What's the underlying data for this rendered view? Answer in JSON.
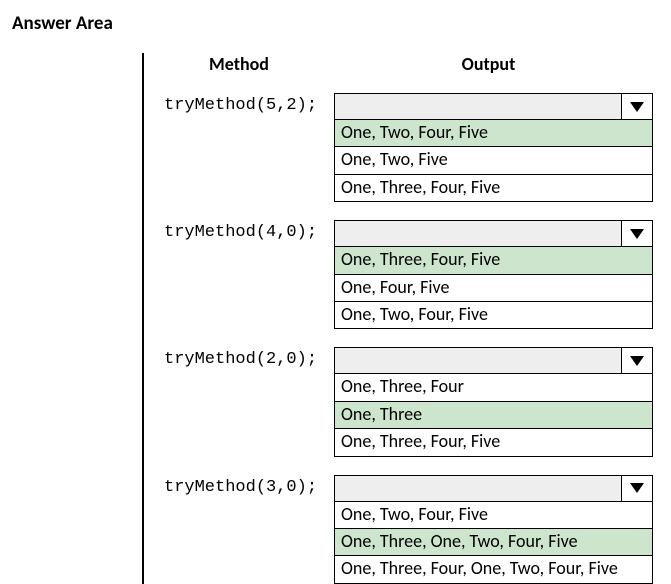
{
  "title": "Answer Area",
  "headers": {
    "method": "Method",
    "output": "Output"
  },
  "rows": [
    {
      "method": "tryMethod(5,2);",
      "options": [
        {
          "text": "One, Two, Four, Five",
          "highlight": true
        },
        {
          "text": "One, Two, Five",
          "highlight": false
        },
        {
          "text": "One, Three, Four, Five",
          "highlight": false
        }
      ]
    },
    {
      "method": "tryMethod(4,0);",
      "options": [
        {
          "text": "One, Three, Four, Five",
          "highlight": true
        },
        {
          "text": "One, Four, Five",
          "highlight": false
        },
        {
          "text": "One, Two, Four, Five",
          "highlight": false
        }
      ]
    },
    {
      "method": "tryMethod(2,0);",
      "options": [
        {
          "text": "One, Three, Four",
          "highlight": false
        },
        {
          "text": "One, Three",
          "highlight": true
        },
        {
          "text": "One, Three, Four, Five",
          "highlight": false
        }
      ]
    },
    {
      "method": "tryMethod(3,0);",
      "options": [
        {
          "text": "One, Two, Four, Five",
          "highlight": false
        },
        {
          "text": "One, Three, One, Two, Four, Five",
          "highlight": true
        },
        {
          "text": "One, Three, Four, One, Two, Four, Five",
          "highlight": false
        }
      ]
    }
  ]
}
